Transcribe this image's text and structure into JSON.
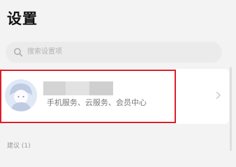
{
  "header": {
    "title": "设置"
  },
  "search": {
    "placeholder": "搜索设置项",
    "icon": "search-icon"
  },
  "account": {
    "name": "",
    "services_text": "手机服务、云服务、会员中心",
    "avatar_icon": "avatar-icon",
    "chevron_icon": "chevron-right-icon"
  },
  "sections": {
    "suggestions_label": "建议 (1)"
  },
  "colors": {
    "background": "#f3f3f3",
    "highlight": "#dc1f2a",
    "card": "#ffffff",
    "avatar_bg": "#dfe8f5"
  }
}
